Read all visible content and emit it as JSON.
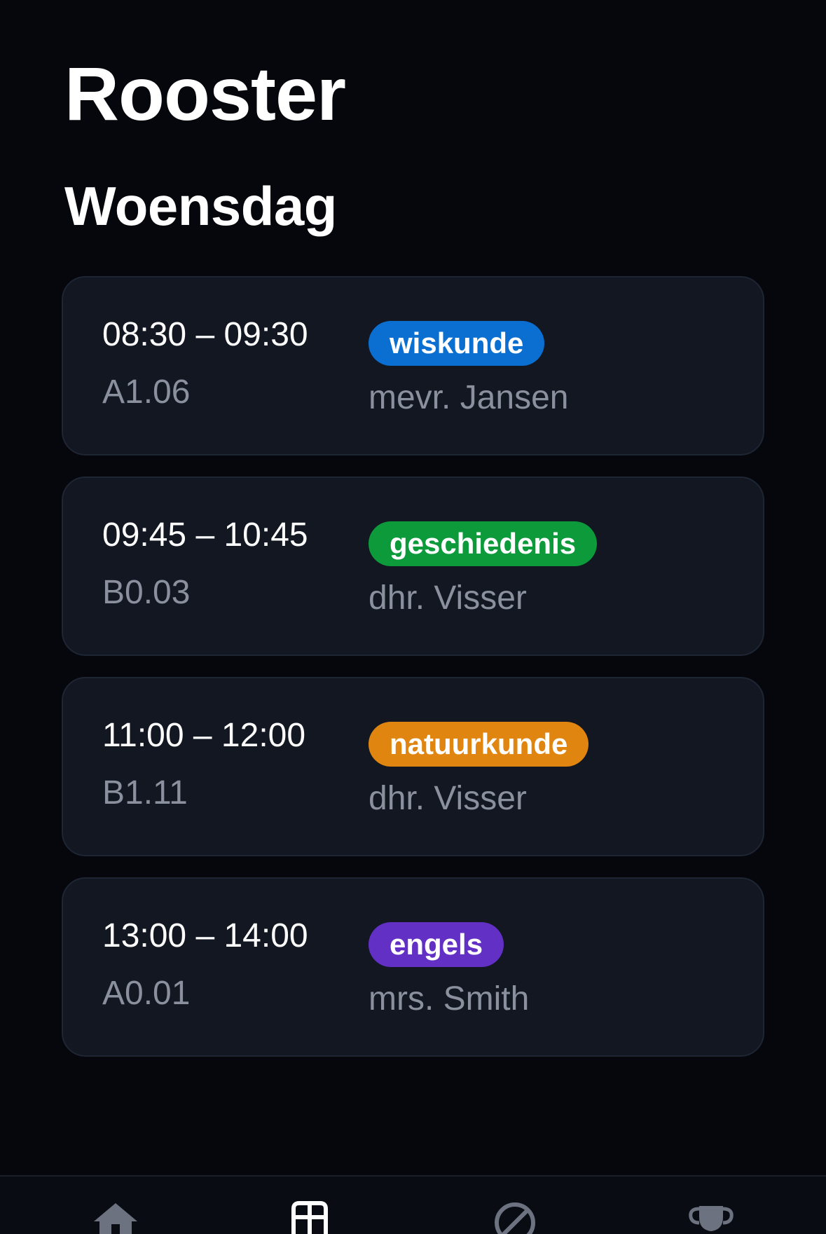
{
  "header": {
    "title": "Rooster",
    "day": "Woensdag"
  },
  "lessons": [
    {
      "time": "08:30 – 09:30",
      "room": "A1.06",
      "subject": "wiskunde",
      "teacher": "mevr. Jansen",
      "color": "#0a6fd1"
    },
    {
      "time": "09:45 – 10:45",
      "room": "B0.03",
      "subject": "geschiedenis",
      "teacher": "dhr. Visser",
      "color": "#0c9a3a"
    },
    {
      "time": "11:00 – 12:00",
      "room": "B1.11",
      "subject": "natuurkunde",
      "teacher": "dhr. Visser",
      "color": "#e08510"
    },
    {
      "time": "13:00 – 14:00",
      "room": "A0.01",
      "subject": "engels",
      "teacher": "mrs. Smith",
      "color": "#6230c4"
    }
  ],
  "tabs": [
    {
      "icon": "home-icon",
      "active": false
    },
    {
      "icon": "schedule-icon",
      "active": true
    },
    {
      "icon": "blocked-icon",
      "active": false
    },
    {
      "icon": "trophy-icon",
      "active": false
    }
  ]
}
